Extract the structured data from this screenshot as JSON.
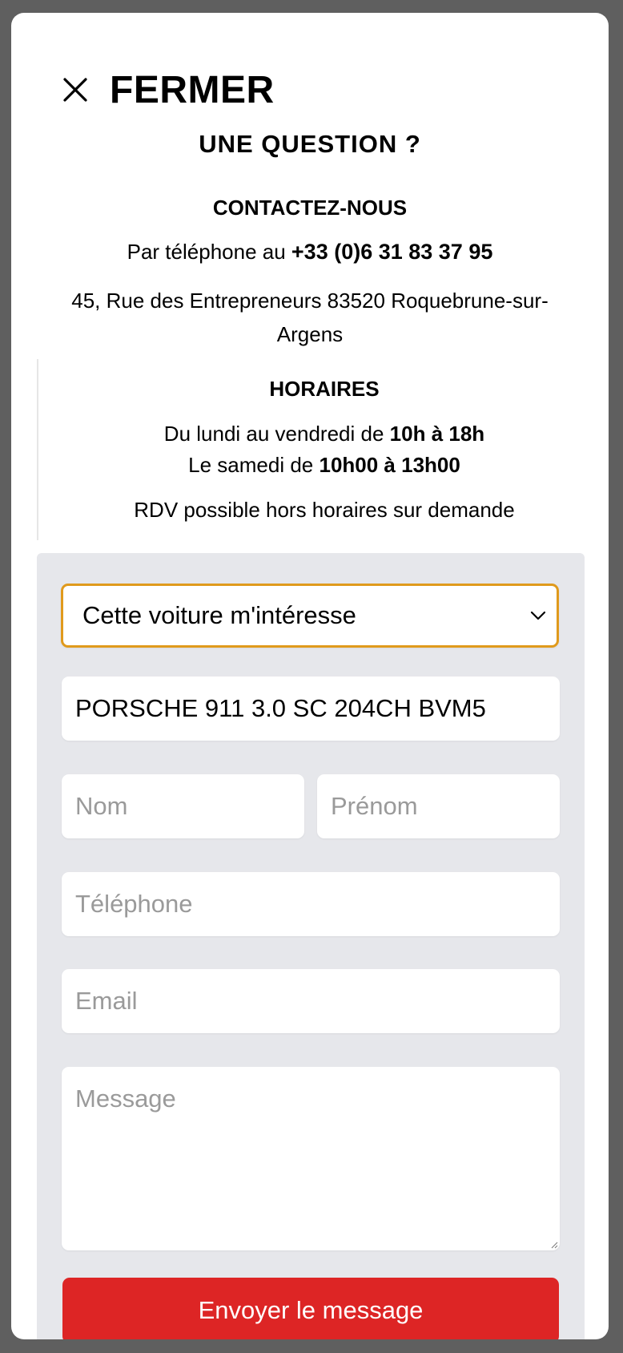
{
  "header": {
    "close_label": "FERMER",
    "close_icon": "close-icon"
  },
  "contact": {
    "title": "UNE QUESTION ?",
    "subtitle": "CONTACTEZ-NOUS",
    "phone_prefix": "Par téléphone au ",
    "phone_number": "+33 (0)6 31 83 37 95",
    "address": "45, Rue des Entrepreneurs 83520 Roquebrune-sur-Argens"
  },
  "hours": {
    "title": "HORAIRES",
    "weekday_prefix": "Du lundi au vendredi de ",
    "weekday_hours": "10h à 18h",
    "saturday_prefix": "Le samedi de ",
    "saturday_hours": "10h00 à 13h00",
    "note": "RDV possible hors horaires sur demande"
  },
  "form": {
    "subject_selected": "Cette voiture m'intéresse",
    "vehicle_value": "PORSCHE 911 3.0 SC 204CH BVM5",
    "last_name_placeholder": "Nom",
    "first_name_placeholder": "Prénom",
    "phone_placeholder": "Téléphone",
    "email_placeholder": "Email",
    "message_placeholder": "Message",
    "submit_label": "Envoyer le message"
  },
  "colors": {
    "background_overlay": "#5f5f5f",
    "panel_background": "#e6e7eb",
    "select_focus_border": "#e09a1c",
    "submit_button": "#dd2525"
  }
}
